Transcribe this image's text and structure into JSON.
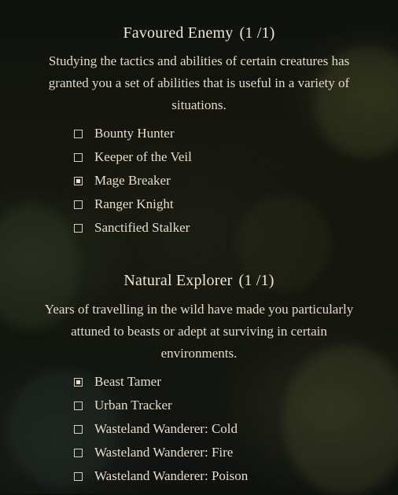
{
  "sections": [
    {
      "title": "Favoured Enemy",
      "count": "(1 /1)",
      "description": "Studying the tactics and abilities of certain creatures has granted you a set of abilities that is useful in a variety of situations.",
      "options": [
        {
          "label": "Bounty Hunter",
          "checked": false
        },
        {
          "label": "Keeper of the Veil",
          "checked": false
        },
        {
          "label": "Mage Breaker",
          "checked": true
        },
        {
          "label": "Ranger Knight",
          "checked": false
        },
        {
          "label": "Sanctified Stalker",
          "checked": false
        }
      ]
    },
    {
      "title": "Natural Explorer",
      "count": "(1 /1)",
      "description": "Years of travelling in the wild have made you particularly attuned to beasts or adept at surviving in certain environments.",
      "options": [
        {
          "label": "Beast Tamer",
          "checked": true
        },
        {
          "label": "Urban Tracker",
          "checked": false
        },
        {
          "label": "Wasteland Wanderer: Cold",
          "checked": false
        },
        {
          "label": "Wasteland Wanderer: Fire",
          "checked": false
        },
        {
          "label": "Wasteland Wanderer: Poison",
          "checked": false
        }
      ]
    }
  ]
}
